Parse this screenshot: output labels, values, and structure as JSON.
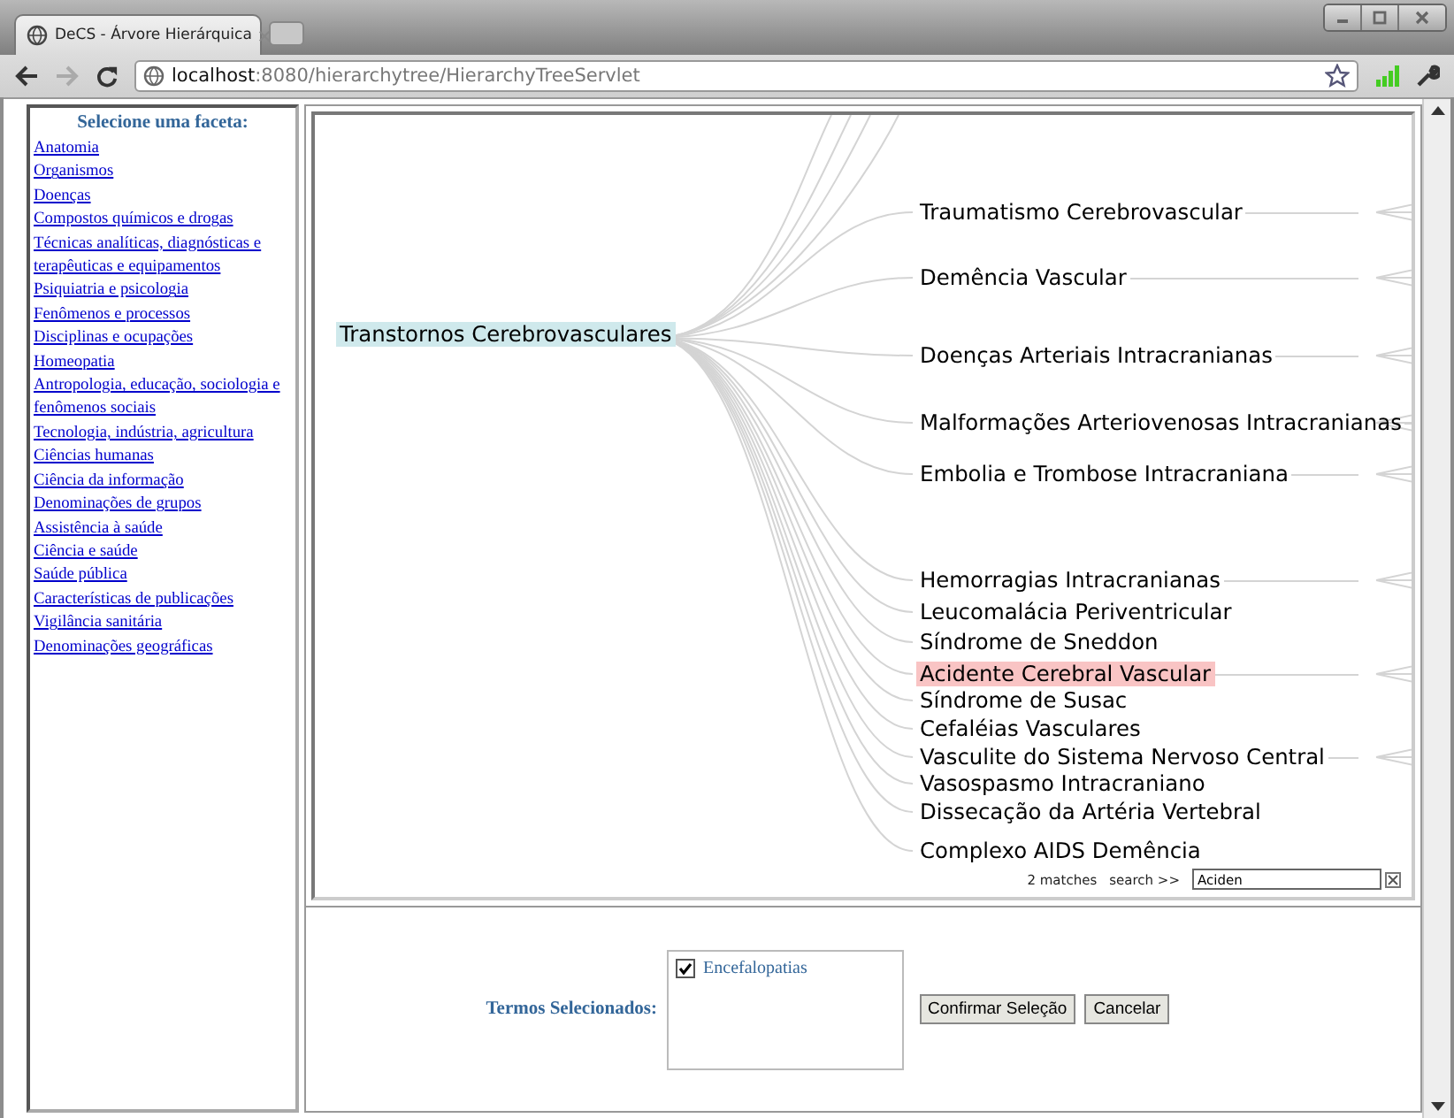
{
  "browser": {
    "tab_title": "DeCS - Árvore Hierárquica",
    "url_host": "localhost",
    "url_rest": ":8080/hierarchytree/HierarchyTreeServlet"
  },
  "sidebar": {
    "heading": "Selecione uma faceta:",
    "items": [
      "Anatomia",
      "Organismos",
      "Doenças",
      "Compostos químicos e drogas",
      "Técnicas analíticas, diagnósticas e terapêuticas e equipamentos",
      "Psiquiatria e psicologia",
      "Fenômenos e processos",
      "Disciplinas e ocupações",
      "Homeopatia",
      "Antropologia, educação, sociologia e fenômenos sociais",
      "Tecnologia, indústria, agricultura",
      "Ciências humanas",
      "Ciência da informação",
      "Denominações de grupos",
      "Assistência à saúde",
      "Ciência e saúde",
      "Saúde pública",
      "Características de publicações",
      "Vigilância sanitária",
      "Denominações geográficas"
    ]
  },
  "tree": {
    "root": {
      "label": "Transtornos Cerebrovasculares",
      "selected": true
    },
    "children": [
      {
        "label": "Traumatismo Cerebrovascular",
        "match": false,
        "has_children": true
      },
      {
        "label": "Demência Vascular",
        "match": false,
        "has_children": true
      },
      {
        "label": "Doenças Arteriais Intracranianas",
        "match": false,
        "has_children": true
      },
      {
        "label": "Malformações Arteriovenosas Intracranianas",
        "match": false,
        "has_children": true
      },
      {
        "label": "Embolia e Trombose Intracraniana",
        "match": false,
        "has_children": true
      },
      {
        "label": "Hemorragias Intracranianas",
        "match": false,
        "has_children": true
      },
      {
        "label": "Leucomalácia Periventricular",
        "match": false,
        "has_children": false
      },
      {
        "label": "Síndrome de Sneddon",
        "match": false,
        "has_children": false
      },
      {
        "label": "Acidente Cerebral Vascular",
        "match": true,
        "has_children": true
      },
      {
        "label": "Síndrome de Susac",
        "match": false,
        "has_children": false
      },
      {
        "label": "Cefaléias Vasculares",
        "match": false,
        "has_children": false
      },
      {
        "label": "Vasculite do Sistema Nervoso Central",
        "match": false,
        "has_children": true
      },
      {
        "label": "Vasospasmo Intracraniano",
        "match": false,
        "has_children": false
      },
      {
        "label": "Dissecação da Artéria Vertebral",
        "match": false,
        "has_children": false
      },
      {
        "label": "Complexo AIDS Demência",
        "match": false,
        "has_children": false
      }
    ],
    "matches": "2 matches",
    "search_label": "search >>",
    "search_value": "Aciden"
  },
  "selection": {
    "label": "Termos Selecionados:",
    "terms": [
      {
        "label": "Encefalopatias",
        "checked": true
      }
    ]
  },
  "buttons": [
    "Confirmar Seleção",
    "Cancelar"
  ]
}
